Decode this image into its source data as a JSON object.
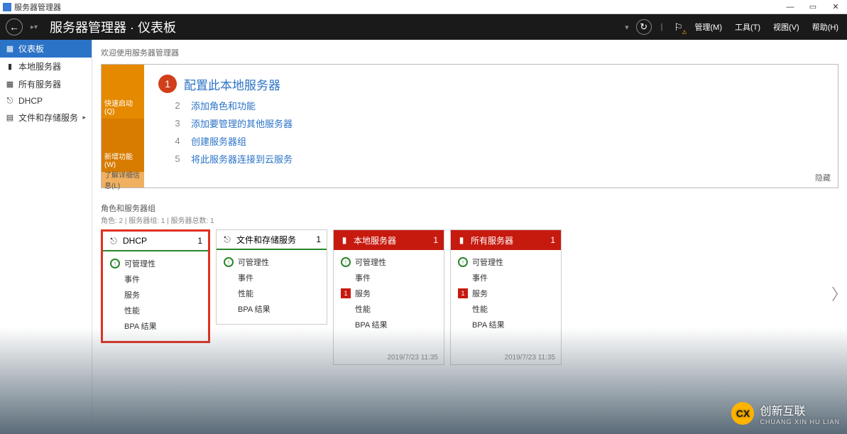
{
  "titlebar": {
    "app": "服务器管理器"
  },
  "header": {
    "title": "服务器管理器 · 仪表板",
    "menus": {
      "manage": "管理(M)",
      "tools": "工具(T)",
      "view": "视图(V)",
      "help": "帮助(H)"
    }
  },
  "sidebar": {
    "items": [
      {
        "icon": "▦",
        "label": "仪表板"
      },
      {
        "icon": "▮",
        "label": "本地服务器"
      },
      {
        "icon": "▦",
        "label": "所有服务器"
      },
      {
        "icon": "⎋",
        "label": "DHCP"
      },
      {
        "icon": "▤",
        "label": "文件和存储服务",
        "arrow": true
      }
    ]
  },
  "welcome": "欢迎使用服务器管理器",
  "quick": {
    "left": {
      "top": "快速启动(Q)",
      "mid": "新增功能(W)",
      "bot": "了解详细信息(L)"
    },
    "main": {
      "num": "1",
      "text": "配置此本地服务器"
    },
    "steps": [
      {
        "num": "2",
        "text": "添加角色和功能"
      },
      {
        "num": "3",
        "text": "添加要管理的其他服务器"
      },
      {
        "num": "4",
        "text": "创建服务器组"
      },
      {
        "num": "5",
        "text": "将此服务器连接到云服务"
      }
    ],
    "hide": "隐藏"
  },
  "roles": {
    "title": "角色和服务器组",
    "sub": "角色: 2 | 服务器组: 1 | 服务器总数: 1"
  },
  "tiles": [
    {
      "type": "ok",
      "hl": true,
      "title": "DHCP",
      "count": "1",
      "rows": [
        {
          "k": "ok",
          "t": "可管理性"
        },
        {
          "k": "",
          "t": "事件"
        },
        {
          "k": "",
          "t": "服务"
        },
        {
          "k": "",
          "t": "性能"
        },
        {
          "k": "",
          "t": "BPA 结果"
        }
      ],
      "ts": ""
    },
    {
      "type": "ok",
      "title": "文件和存储服务",
      "count": "1",
      "rows": [
        {
          "k": "ok",
          "t": "可管理性"
        },
        {
          "k": "",
          "t": "事件"
        },
        {
          "k": "",
          "t": "性能"
        },
        {
          "k": "",
          "t": "BPA 结果"
        }
      ],
      "ts": ""
    },
    {
      "type": "err",
      "title": "本地服务器",
      "count": "1",
      "rows": [
        {
          "k": "ok",
          "t": "可管理性"
        },
        {
          "k": "",
          "t": "事件"
        },
        {
          "k": "err",
          "t": "服务"
        },
        {
          "k": "",
          "t": "性能"
        },
        {
          "k": "",
          "t": "BPA 结果"
        }
      ],
      "ts": "2019/7/23 11:35"
    },
    {
      "type": "err",
      "title": "所有服务器",
      "count": "1",
      "rows": [
        {
          "k": "ok",
          "t": "可管理性"
        },
        {
          "k": "",
          "t": "事件"
        },
        {
          "k": "err",
          "t": "服务"
        },
        {
          "k": "",
          "t": "性能"
        },
        {
          "k": "",
          "t": "BPA 结果"
        }
      ],
      "ts": "2019/7/23 11:35"
    }
  ],
  "watermark": {
    "brand": "创新互联",
    "sub": "CHUANG XIN HU LIAN"
  },
  "errnum": "1"
}
